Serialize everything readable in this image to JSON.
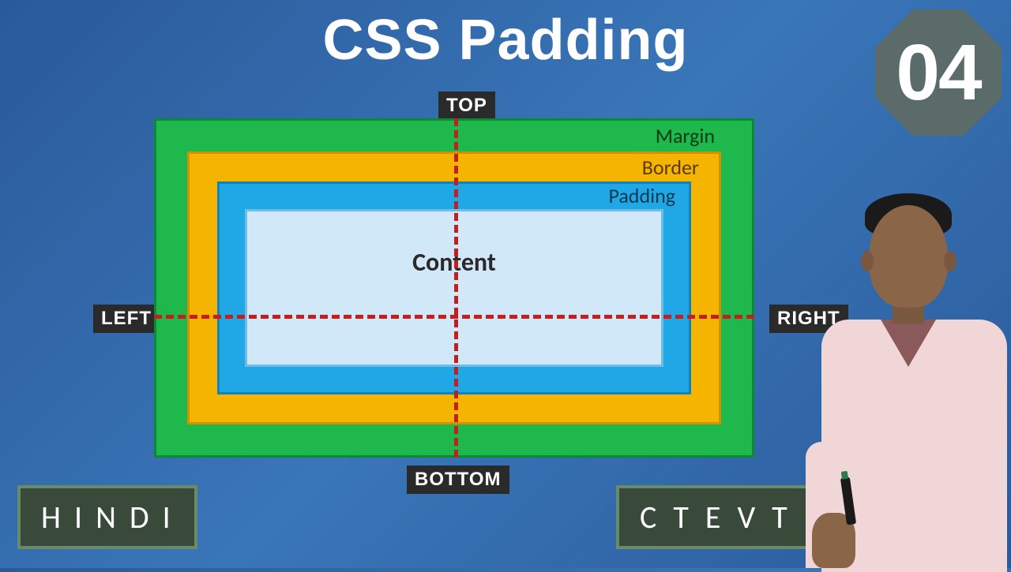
{
  "title": "CSS Padding",
  "badge_number": "04",
  "directions": {
    "top": "TOP",
    "bottom": "BOTTOM",
    "left": "LEFT",
    "right": "RIGHT"
  },
  "box_model": {
    "margin": "Margin",
    "border": "Border",
    "padding": "Padding",
    "content": "Content"
  },
  "footer": {
    "left": "H I N D I",
    "right": "C T E V T"
  },
  "chart_data": {
    "type": "diagram",
    "concept": "CSS Box Model",
    "layers": [
      {
        "name": "Margin",
        "color": "#1fb84d",
        "order": 1,
        "outermost": true
      },
      {
        "name": "Border",
        "color": "#f5b400",
        "order": 2
      },
      {
        "name": "Padding",
        "color": "#1fa8e5",
        "order": 3
      },
      {
        "name": "Content",
        "color": "#d0e8f7",
        "order": 4,
        "innermost": true
      }
    ],
    "axes": [
      "TOP",
      "RIGHT",
      "BOTTOM",
      "LEFT"
    ],
    "annotations": [
      "dashed crosshair lines indicating top/right/bottom/left directions"
    ]
  }
}
